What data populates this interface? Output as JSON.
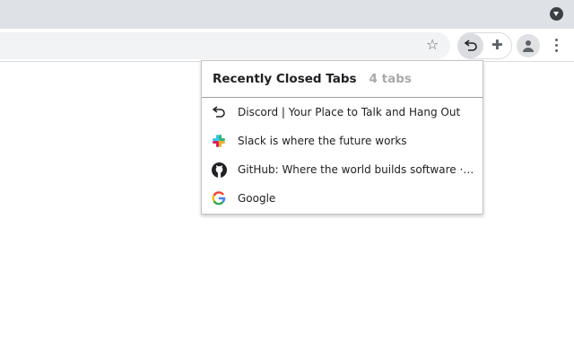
{
  "browser": {
    "toolbar_icons": [
      "tab-search-icon",
      "bookmark-star-icon",
      "recently-closed-extension-icon",
      "extensions-puzzle-icon",
      "profile-avatar-icon",
      "menu-dots-icon"
    ]
  },
  "popup": {
    "title": "Recently Closed Tabs",
    "count": "4 tabs",
    "items": [
      {
        "label": "Discord | Your Place to Talk and Hang Out",
        "icon": "undo-arrow-icon"
      },
      {
        "label": "Slack is where the future works",
        "icon": "slack-icon"
      },
      {
        "label": "GitHub: Where the world builds software · GitHub",
        "icon": "github-icon"
      },
      {
        "label": "Google",
        "icon": "google-icon"
      }
    ]
  }
}
